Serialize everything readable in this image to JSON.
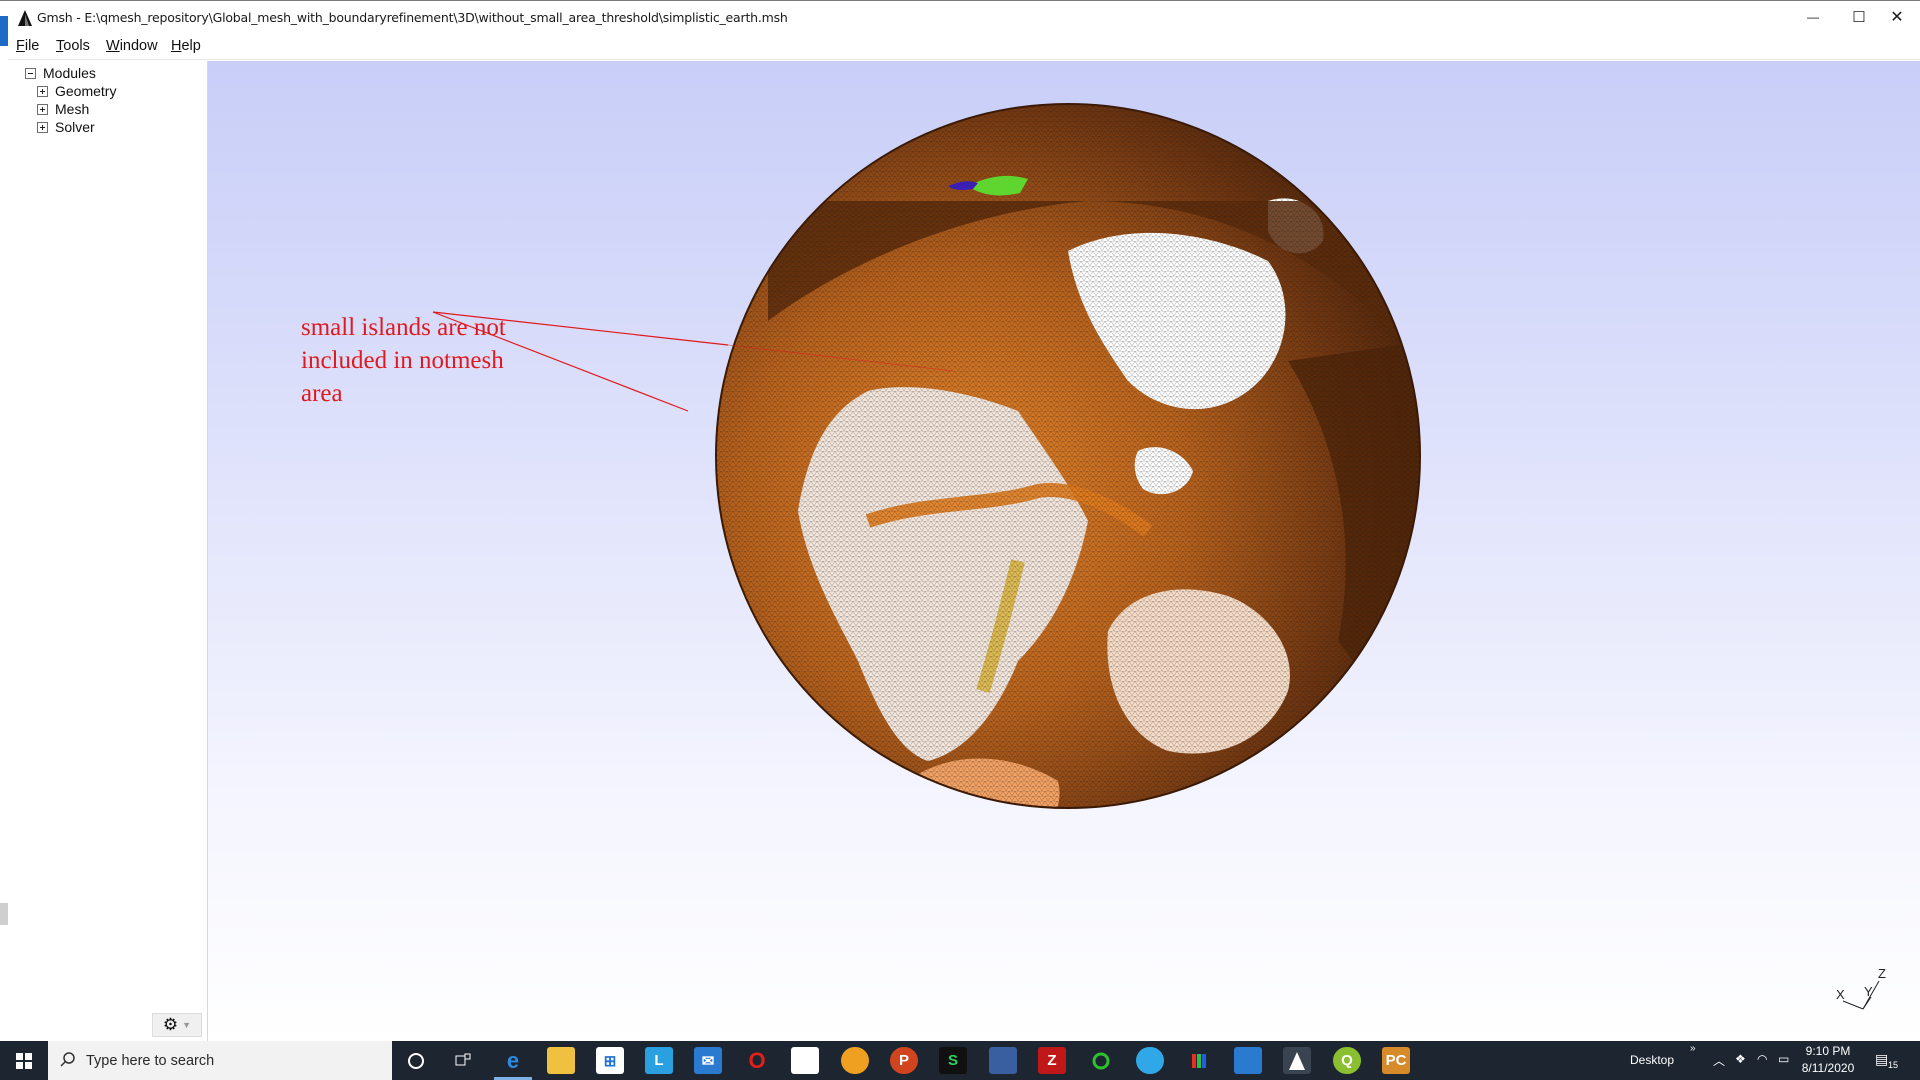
{
  "window": {
    "title": "Gmsh - E:\\qmesh_repository\\Global_mesh_with_boundaryrefinement\\3D\\without_small_area_threshold\\simplistic_earth.msh",
    "controls": {
      "minimize": "—",
      "maximize": "☐",
      "close": "✕"
    }
  },
  "menu": {
    "items": [
      {
        "key": "F",
        "rest": "ile"
      },
      {
        "key": "T",
        "rest": "ools"
      },
      {
        "key": "W",
        "rest": "indow"
      },
      {
        "key": "H",
        "rest": "elp"
      }
    ]
  },
  "tree": {
    "root": "Modules",
    "children": [
      "Geometry",
      "Mesh",
      "Solver"
    ]
  },
  "viewport": {
    "annotation": "small islands are not\nincluded in notmesh\narea",
    "annotation_color": "#e0191f",
    "background_top": "#c8cef8",
    "background_bottom": "#ffffff",
    "mesh_colors": {
      "deep_ocean": "#5a2a0a",
      "ocean": "#9b5016",
      "coast": "#e07a1c",
      "land": "#f6e8dc",
      "mesh_line": "#1a1a1a"
    },
    "axis_labels": {
      "x": "X",
      "y": "Y",
      "z": "Z"
    }
  },
  "taskbar": {
    "search_placeholder": "Type here to search",
    "apps": [
      "cortana-icon",
      "task-view-icon",
      "edge-icon",
      "file-explorer-icon",
      "store-icon",
      "l-app-icon",
      "mail-icon",
      "opera-icon",
      "notepad-icon",
      "brave-icon",
      "powerpoint-icon",
      "s-app-icon",
      "network-app-icon",
      "filezilla-icon",
      "green-ring-icon",
      "blue-bubble-icon",
      "color-app-icon",
      "photos-icon",
      "gmsh-icon",
      "qgis-icon",
      "pycharm-icon"
    ],
    "desktop_label": "Desktop",
    "time": "9:10 PM",
    "date": "8/11/2020",
    "notifications": "15"
  }
}
